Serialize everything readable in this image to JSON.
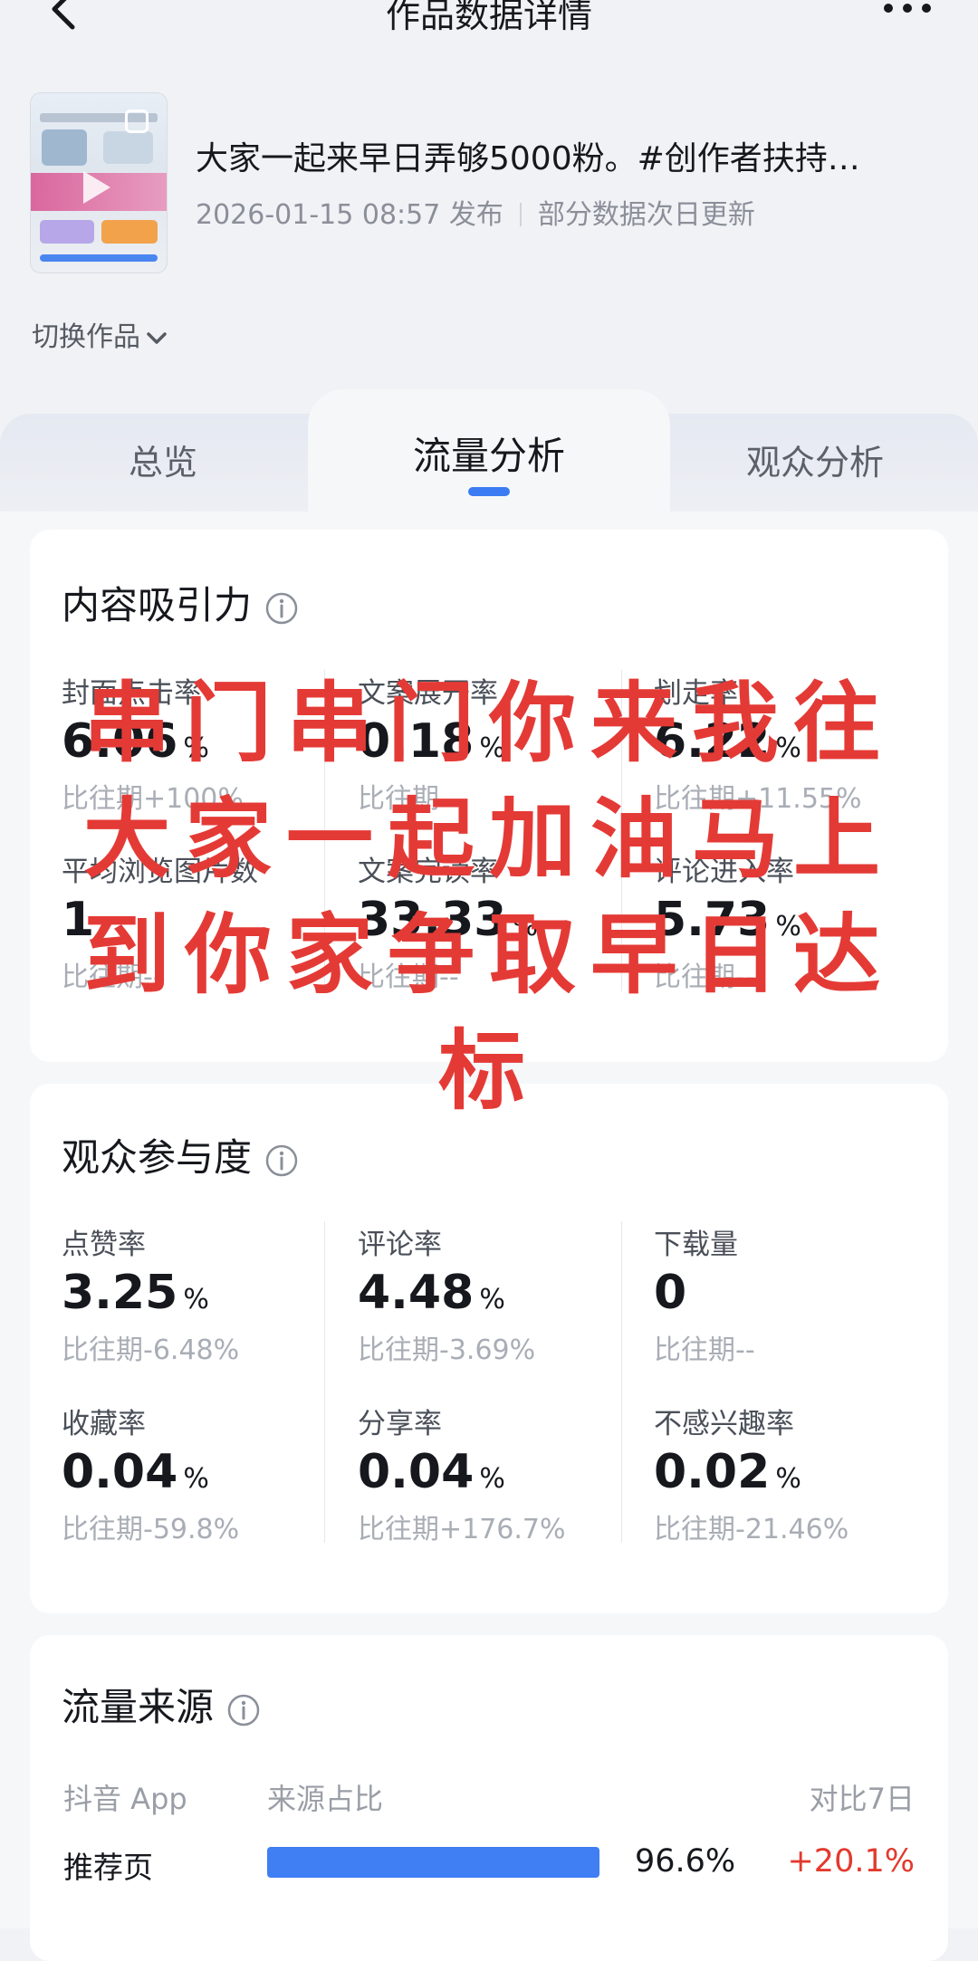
{
  "header": {
    "title": "作品数据详情"
  },
  "work": {
    "title": "大家一起来早日弄够5000粉。#创作者扶持…",
    "publish_time": "2026-01-15 08:57 发布",
    "update_note": "部分数据次日更新",
    "switch_label": "切换作品"
  },
  "tabs": [
    {
      "label": "总览",
      "active": false
    },
    {
      "label": "流量分析",
      "active": true
    },
    {
      "label": "观众分析",
      "active": false
    }
  ],
  "colors": {
    "accent": "#3b7cf2",
    "overlay_text": "#e43a36",
    "positive_change": "#e23a2e"
  },
  "content_appeal": {
    "title": "内容吸引力",
    "metrics": [
      {
        "label": "封面点击率",
        "value": "6.06",
        "unit": "%",
        "compare": "比往期+100%"
      },
      {
        "label": "文案展开率",
        "value": "0.18",
        "unit": "%",
        "compare": "比往期--"
      },
      {
        "label": "划走率",
        "value": "6.22",
        "unit": "%",
        "compare": "比往期+11.55%"
      },
      {
        "label": "平均浏览图片数",
        "value": "1",
        "unit": "",
        "compare": "比往期--"
      },
      {
        "label": "文案完读率",
        "value": "33.33",
        "unit": "%",
        "compare": "比往期--"
      },
      {
        "label": "评论进入率",
        "value": "5.73",
        "unit": "%",
        "compare": "比往期--"
      }
    ]
  },
  "audience_engagement": {
    "title": "观众参与度",
    "metrics": [
      {
        "label": "点赞率",
        "value": "3.25",
        "unit": "%",
        "compare": "比往期-6.48%"
      },
      {
        "label": "评论率",
        "value": "4.48",
        "unit": "%",
        "compare": "比往期-3.69%"
      },
      {
        "label": "下载量",
        "value": "0",
        "unit": "",
        "compare": "比往期--"
      },
      {
        "label": "收藏率",
        "value": "0.04",
        "unit": "%",
        "compare": "比往期-59.8%"
      },
      {
        "label": "分享率",
        "value": "0.04",
        "unit": "%",
        "compare": "比往期+176.7%"
      },
      {
        "label": "不感兴趣率",
        "value": "0.02",
        "unit": "%",
        "compare": "比往期-21.46%"
      }
    ]
  },
  "traffic_source": {
    "title": "流量来源",
    "col_source": "抖音 App",
    "col_share": "来源占比",
    "col_compare": "对比7日",
    "rows": [
      {
        "label": "推荐页",
        "share": 96.6,
        "share_text": "96.6%",
        "change": "+20.1%"
      }
    ]
  },
  "overlay_text": [
    "串门串门你来我往",
    "大家一起加油马上",
    "到你家争取早日达",
    "标"
  ]
}
